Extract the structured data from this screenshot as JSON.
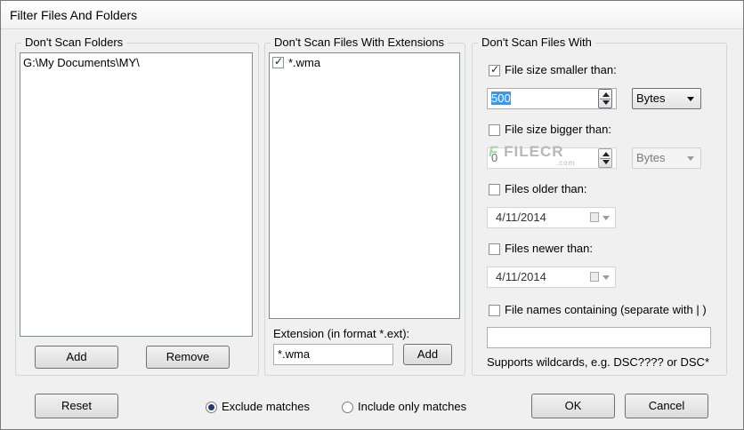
{
  "window": {
    "title": "Filter Files And Folders"
  },
  "folders": {
    "label": "Don't Scan Folders",
    "items": [
      "G:\\My Documents\\MY\\"
    ],
    "add_label": "Add",
    "remove_label": "Remove"
  },
  "extensions": {
    "label": "Don't Scan Files With Extensions",
    "items": [
      {
        "text": "*.wma",
        "checked": true
      }
    ],
    "ext_label": "Extension (in format *.ext):",
    "ext_value": "*.wma",
    "add_label": "Add"
  },
  "files_with": {
    "label": "Don't Scan Files With",
    "size_smaller": {
      "label": "File size smaller than:",
      "checked": true,
      "value": "500",
      "unit": "Bytes"
    },
    "size_bigger": {
      "label": "File size bigger than:",
      "checked": false,
      "value": "0",
      "unit": "Bytes"
    },
    "older": {
      "label": "Files older than:",
      "checked": false,
      "date": "4/11/2014"
    },
    "newer": {
      "label": "Files newer than:",
      "checked": false,
      "date": "4/11/2014"
    },
    "names": {
      "label": "File names containing (separate with | )",
      "checked": false,
      "value": ""
    },
    "wildcards_hint": "Supports wildcards, e.g. DSC???? or DSC*"
  },
  "watermark": {
    "text": "FILECR",
    "sub": ".com"
  },
  "footer": {
    "reset_label": "Reset",
    "exclude_label": "Exclude matches",
    "include_label": "Include only matches",
    "exclude_checked": true,
    "ok_label": "OK",
    "cancel_label": "Cancel"
  }
}
